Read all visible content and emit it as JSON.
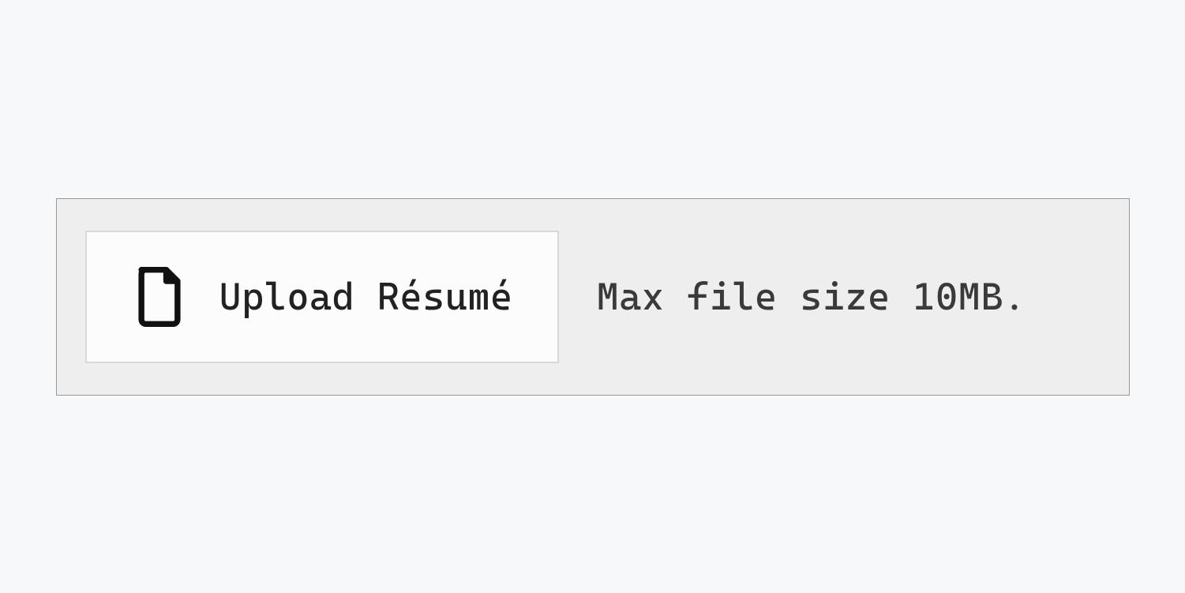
{
  "upload": {
    "button_label": "Upload Résumé",
    "hint": "Max file size 10MB."
  }
}
